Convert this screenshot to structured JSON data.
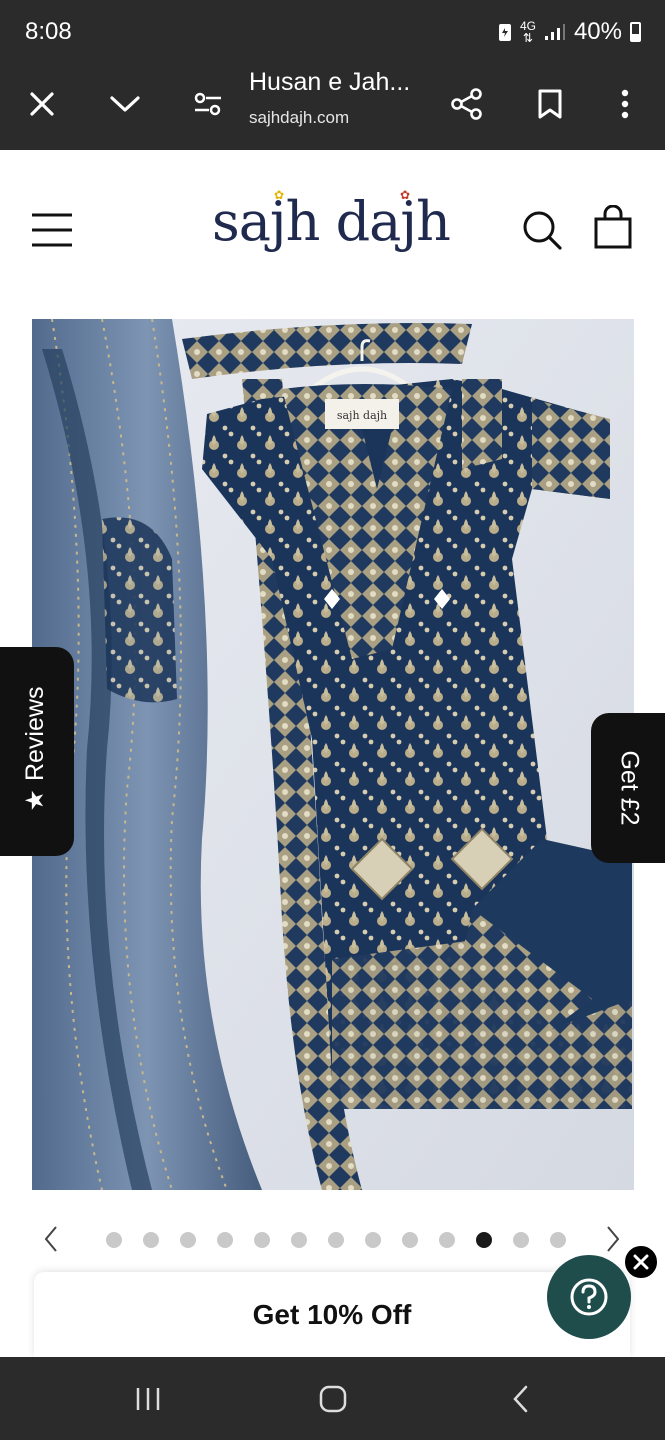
{
  "status_bar": {
    "time": "8:08",
    "network_top": "4G",
    "battery_text": "40%"
  },
  "browser": {
    "page_title": "Husan e Jah...",
    "url": "sajhdajh.com"
  },
  "site": {
    "logo_text": "sajh dajh",
    "label_tag_text": "sajh dajh"
  },
  "side_tabs": {
    "reviews_label": "Reviews",
    "get_label": "Get £2"
  },
  "carousel": {
    "dot_count": 13,
    "active_index": 10
  },
  "promo": {
    "label": "Get 10% Off"
  },
  "colors": {
    "chrome": "#2b2b2b",
    "brand_navy": "#1f2a4e",
    "help_teal": "#1f4d4c",
    "dress_navy": "#173151"
  }
}
